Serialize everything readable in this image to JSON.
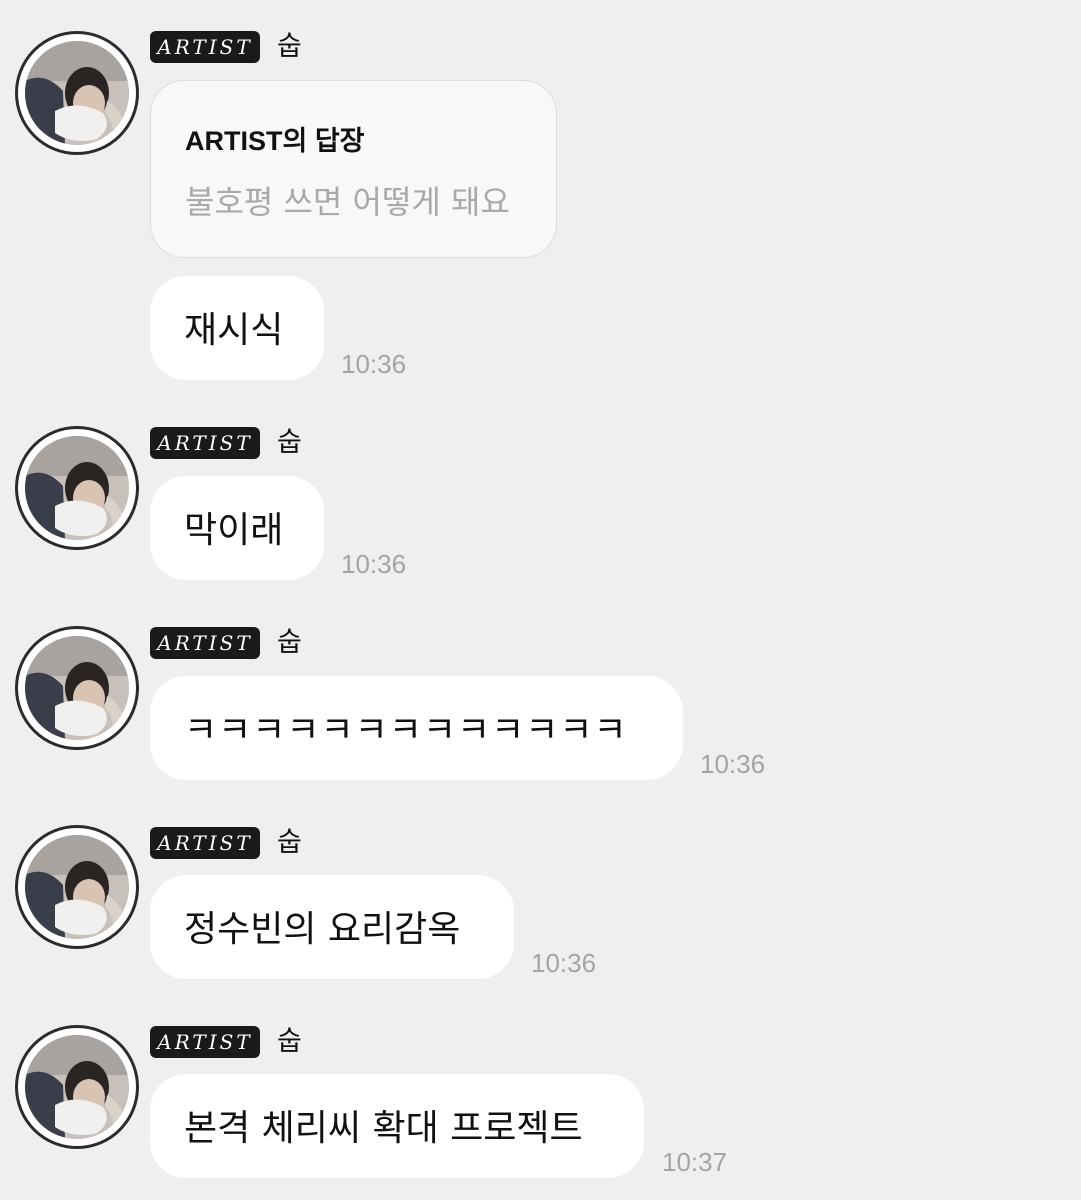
{
  "badge_label": "ARTIST",
  "sender_name": "숩",
  "reply": {
    "title": "ARTIST의 답장",
    "quoted_text": "불호평 쓰면 어떻게 돼요"
  },
  "messages": [
    {
      "text": "재시식",
      "time": "10:36"
    },
    {
      "text": "막이래",
      "time": "10:36"
    },
    {
      "text": "ㅋㅋㅋㅋㅋㅋㅋㅋㅋㅋㅋㅋㅋ",
      "time": "10:36"
    },
    {
      "text": "정수빈의 요리감옥",
      "time": "10:36"
    },
    {
      "text": "본격 체리씨 확대 프로젝트",
      "time": "10:37"
    }
  ]
}
